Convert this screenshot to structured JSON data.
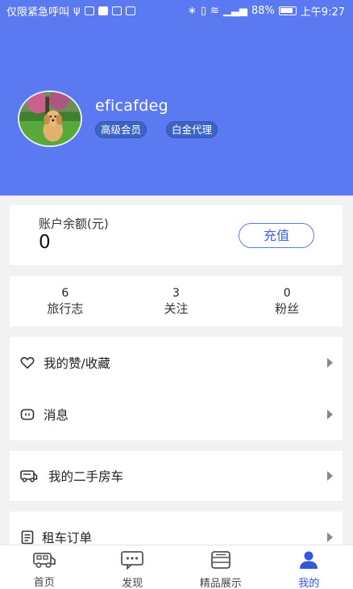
{
  "status_bar": {
    "left_text": "仅限紧急呼叫",
    "battery": "88%",
    "time": "上午9:27"
  },
  "profile": {
    "username": "eficafdeg",
    "badges": [
      "高级会员",
      "白金代理"
    ]
  },
  "balance": {
    "label": "账户余额(元)",
    "value": "0",
    "recharge_label": "充值"
  },
  "stats": [
    {
      "count": "6",
      "label": "旅行志"
    },
    {
      "count": "3",
      "label": "关注"
    },
    {
      "count": "0",
      "label": "粉丝"
    }
  ],
  "menu": {
    "likes": "我的赞/收藏",
    "messages": "消息",
    "used_rv": "我的二手房车",
    "rental_orders": "租车订单"
  },
  "tabbar": {
    "items": [
      {
        "label": "首页",
        "icon": "rv-icon"
      },
      {
        "label": "发现",
        "icon": "chat-icon"
      },
      {
        "label": "精品展示",
        "icon": "showcase-icon"
      },
      {
        "label": "我的",
        "icon": "user-icon"
      }
    ],
    "active_color": "#3557d9"
  },
  "colors": {
    "header_bg": "#5b79f0",
    "accent": "#3d62d8"
  }
}
